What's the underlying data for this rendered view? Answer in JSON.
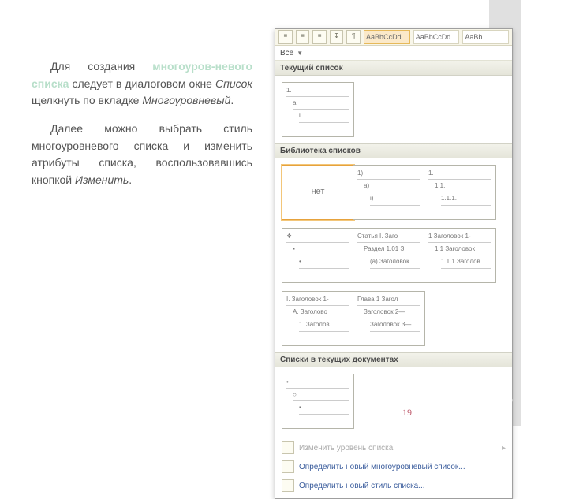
{
  "slide": {
    "body_html_parts": {
      "p1_a": "Для создания ",
      "p1_highlight": "многоуров-невого списка",
      "p1_b": " следует в диалоговом окне ",
      "p1_em1": "Список",
      "p1_c": " щелкнуть по вкладке ",
      "p1_em2": "Многоуровневый",
      "p1_d": ".",
      "p2_a": "Далее можно выбрать стиль многоуровневого  списка и  изменить  атрибуты  списка, воспользовавшись кнопкой ",
      "p2_em": "Изменить",
      "p2_b": "."
    },
    "page_number": "19",
    "footer_link": "ало"
  },
  "panel": {
    "ribbon_styles": [
      "AaBbCcDd",
      "AaBbCcDd",
      "AaBb"
    ],
    "dropdown_label": "Все",
    "section_current": "Текущий список",
    "section_library": "Библиотека списков",
    "section_current_docs": "Списки в текущих документах",
    "none_label": "нет",
    "opt_change_level": "Изменить уровень списка",
    "opt_new_multilevel": "Определить новый многоуровневый список...",
    "opt_new_style": "Определить новый стиль списка...",
    "thumbs": {
      "current": {
        "l1": "1.",
        "l2": "a.",
        "l3": "i."
      },
      "lib": [
        {
          "type": "none"
        },
        {
          "l1": "1)",
          "l2": "a)",
          "l3": "i)"
        },
        {
          "l1": "1.",
          "l2": "1.1.",
          "l3": "1.1.1."
        },
        {
          "l1": "❖",
          "l2": "▪",
          "l3": "•"
        },
        {
          "l1": "Статья I. Заго",
          "l2": "Раздел 1.01 З",
          "l3": "(a) Заголовок"
        },
        {
          "l1": "1 Заголовок 1-",
          "l2": "1.1 Заголовок",
          "l3": "1.1.1 Заголов"
        },
        {
          "l1": "I. Заголовок 1-",
          "l2": "A. Заголово",
          "l3": "1. Заголов"
        },
        {
          "l1": "Глава 1 Загол",
          "l2": "Заголовок 2—",
          "l3": "Заголовок 3—"
        }
      ],
      "cdoc": {
        "l1": "•",
        "l2": "○",
        "l3": "▪"
      }
    }
  }
}
